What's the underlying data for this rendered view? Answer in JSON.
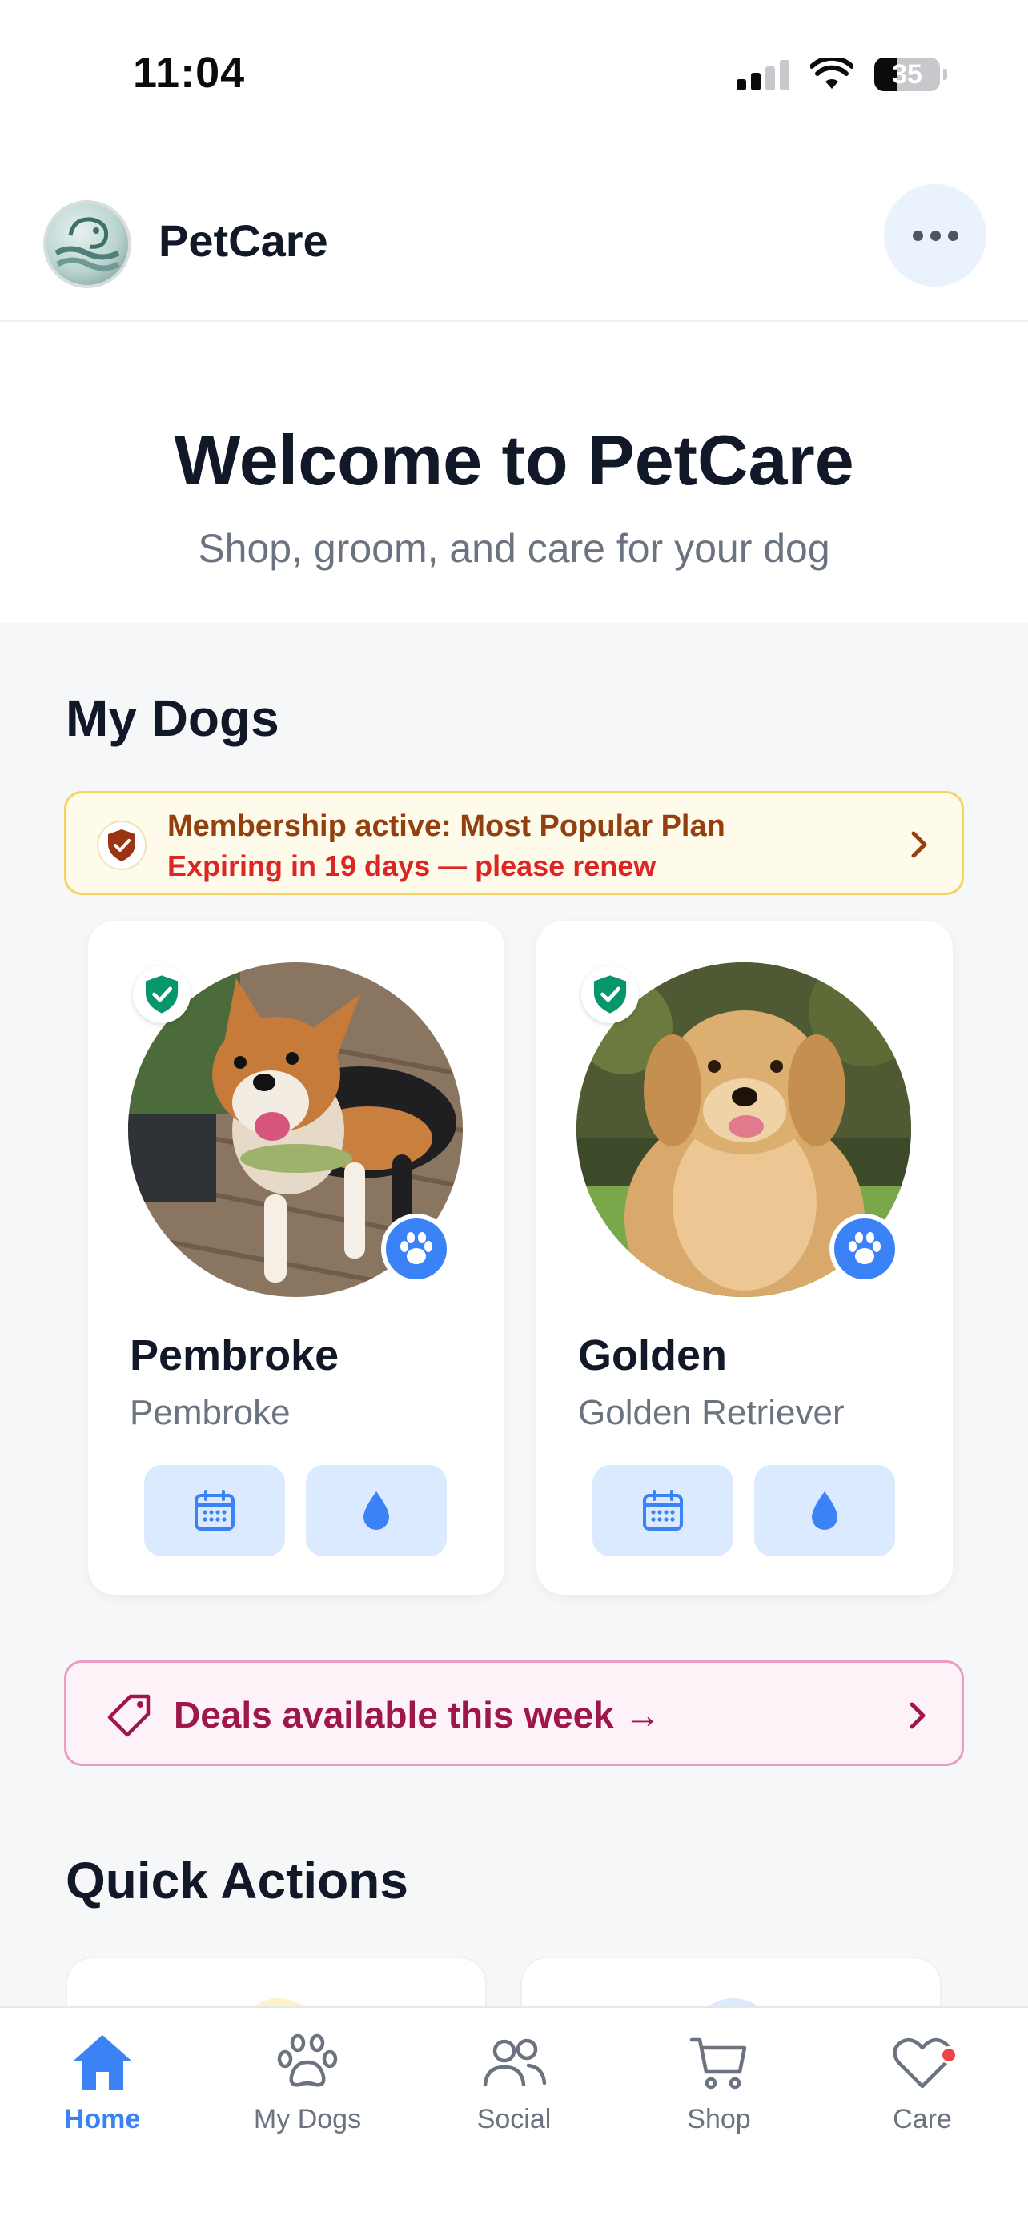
{
  "status_bar": {
    "time": "11:04",
    "battery": "35"
  },
  "header": {
    "app_name": "PetCare"
  },
  "hero": {
    "title": "Welcome to PetCare",
    "subtitle": "Shop, groom, and care for your dog"
  },
  "my_dogs": {
    "title": "My Dogs",
    "membership": {
      "status": "Membership active: Most Popular Plan",
      "warning": "Expiring in 19 days — please renew"
    },
    "dogs": [
      {
        "name": "Pembroke",
        "breed": "Pembroke"
      },
      {
        "name": "Golden",
        "breed": "Golden Retriever"
      }
    ]
  },
  "deals": {
    "label": "Deals available this week →"
  },
  "quick_actions": {
    "title": "Quick Actions"
  },
  "tabbar": {
    "items": [
      {
        "label": "Home",
        "icon": "home-icon",
        "active": true
      },
      {
        "label": "My Dogs",
        "icon": "paw-icon",
        "active": false
      },
      {
        "label": "Social",
        "icon": "people-icon",
        "active": false
      },
      {
        "label": "Shop",
        "icon": "cart-icon",
        "active": false
      },
      {
        "label": "Care",
        "icon": "heart-icon",
        "active": false
      }
    ]
  },
  "colors": {
    "accent": "#3b82f6",
    "membership_text": "#92400e",
    "warning_text": "#dc2626",
    "deals_text": "#9d174d",
    "verified": "#059669"
  }
}
